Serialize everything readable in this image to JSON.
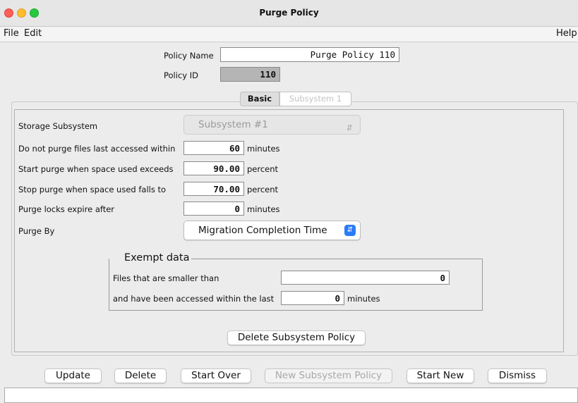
{
  "window": {
    "title": "Purge Policy"
  },
  "menu": {
    "file": "File",
    "edit": "Edit",
    "help": "Help"
  },
  "policy": {
    "name_label": "Policy Name",
    "name_value": "Purge Policy 110",
    "id_label": "Policy ID",
    "id_value": "110"
  },
  "tabs": [
    {
      "label": "Basic",
      "selected": true
    },
    {
      "label": "Subsystem 1",
      "selected": false
    }
  ],
  "form": {
    "storage_label": "Storage Subsystem",
    "storage_value": "Subsystem #1",
    "accessed_label": "Do not purge files last accessed within",
    "accessed_value": "60",
    "accessed_unit": "minutes",
    "start_label": "Start purge when space used exceeds",
    "start_value": "90.00",
    "start_unit": "percent",
    "stop_label": "Stop purge when space used falls to",
    "stop_value": "70.00",
    "stop_unit": "percent",
    "locks_label": "Purge locks expire after",
    "locks_value": "0",
    "locks_unit": "minutes",
    "purgeby_label": "Purge By",
    "purgeby_value": "Migration Completion Time"
  },
  "exempt": {
    "title": "Exempt data",
    "smaller_label": "Files that are smaller than",
    "smaller_value": "0",
    "accessed_label": "and have been accessed within the last",
    "accessed_value": "0",
    "accessed_unit": "minutes"
  },
  "buttons": {
    "delete_subsystem": "Delete Subsystem Policy",
    "update": "Update",
    "delete": "Delete",
    "start_over": "Start Over",
    "new_subsystem": "New Subsystem Policy",
    "start_new": "Start New",
    "dismiss": "Dismiss"
  },
  "icons": {
    "select_arrows": "up-down-chevron-icon",
    "window_close": "close-icon",
    "window_minimize": "minimize-icon",
    "window_maximize": "maximize-icon"
  }
}
